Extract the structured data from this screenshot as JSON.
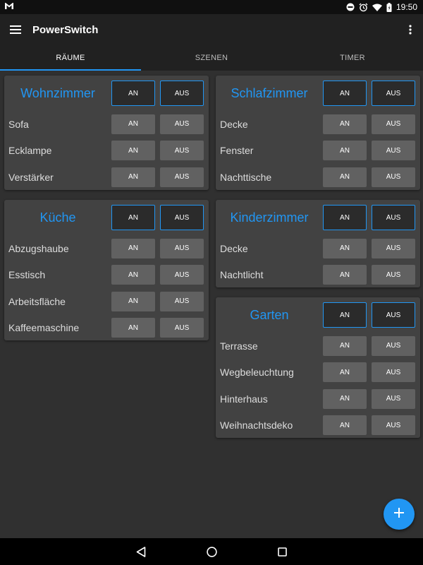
{
  "status_bar": {
    "time": "19:50"
  },
  "app_bar": {
    "title": "PowerSwitch"
  },
  "tabs": [
    {
      "label": "RÄUME",
      "active": true
    },
    {
      "label": "SZENEN",
      "active": false
    },
    {
      "label": "TIMER",
      "active": false
    }
  ],
  "button_labels": {
    "on": "AN",
    "off": "AUS"
  },
  "rooms": [
    {
      "name": "Wohnzimmer",
      "devices": [
        "Sofa",
        "Ecklampe",
        "Verstärker"
      ]
    },
    {
      "name": "Küche",
      "devices": [
        "Abzugshaube",
        "Esstisch",
        "Arbeitsfläche",
        "Kaffeemaschine"
      ]
    },
    {
      "name": "Schlafzimmer",
      "devices": [
        "Decke",
        "Fenster",
        "Nachttische"
      ]
    },
    {
      "name": "Kinderzimmer",
      "devices": [
        "Decke",
        "Nachtlicht"
      ]
    },
    {
      "name": "Garten",
      "devices": [
        "Terrasse",
        "Wegbeleuchtung",
        "Hinterhaus",
        "Weihnachtsdeko"
      ]
    }
  ],
  "colors": {
    "accent": "#2196f3",
    "background": "#303030",
    "card": "#424242",
    "button": "#616161"
  },
  "icons": {
    "fab": "plus-icon",
    "menu": "hamburger-menu-icon",
    "overflow": "more-vert-icon"
  }
}
